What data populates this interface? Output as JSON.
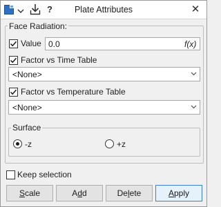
{
  "window": {
    "title": "Plate Attributes",
    "close_glyph": "✕",
    "toolbar_help": "?"
  },
  "face_radiation": {
    "group_label": "Face Radiation:",
    "value": {
      "checked": true,
      "label": "Value",
      "input": "0.0",
      "fx_label": "f(x)"
    },
    "factor_time": {
      "checked": true,
      "label": "Factor vs Time Table",
      "selected": "<None>"
    },
    "factor_temp": {
      "checked": true,
      "label": "Factor vs Temperature Table",
      "selected": "<None>"
    },
    "surface": {
      "label": "Surface",
      "options": [
        {
          "label": "-z",
          "selected": true
        },
        {
          "label": "+z",
          "selected": false
        }
      ]
    }
  },
  "keep_selection": {
    "checked": false,
    "label": "Keep selection"
  },
  "buttons": {
    "scale": {
      "pre": "",
      "u": "S",
      "post": "cale"
    },
    "add": {
      "pre": "A",
      "u": "d",
      "post": "d"
    },
    "delete": {
      "pre": "De",
      "u": "l",
      "post": "ete"
    },
    "apply": {
      "pre": "",
      "u": "A",
      "post": "pply"
    }
  },
  "colors": {
    "accent": "#2e6fc8",
    "default_button_border": "#3c7fd0"
  },
  "icons": [
    "color-square-icon",
    "dropdown-arrow-icon",
    "download-arrow-icon",
    "help-icon",
    "close-icon"
  ]
}
